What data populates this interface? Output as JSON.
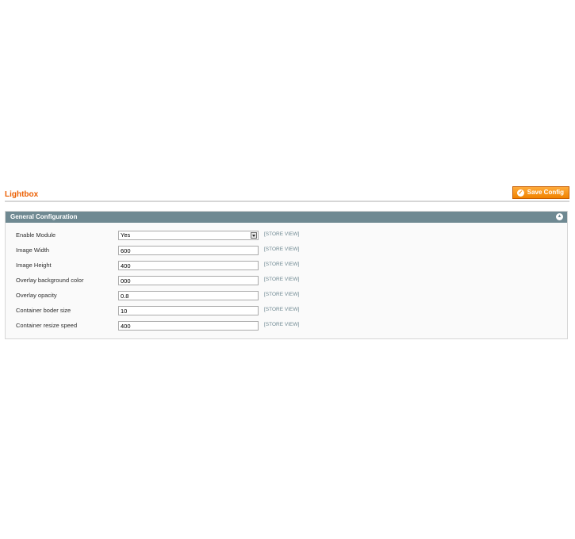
{
  "page": {
    "title": "Lightbox",
    "save_label": "Save Config"
  },
  "section": {
    "title": "General Configuration"
  },
  "fields": [
    {
      "label": "Enable Module",
      "value": "Yes",
      "scope": "[STORE VIEW]"
    },
    {
      "label": "Image Width",
      "value": "600",
      "scope": "[STORE VIEW]"
    },
    {
      "label": "Image Height",
      "value": "400",
      "scope": "[STORE VIEW]"
    },
    {
      "label": "Overlay background color",
      "value": "000",
      "scope": "[STORE VIEW]"
    },
    {
      "label": "Overlay opacity",
      "value": "0.8",
      "scope": "[STORE VIEW]"
    },
    {
      "label": "Container boder size",
      "value": "10",
      "scope": "[STORE VIEW]"
    },
    {
      "label": "Container resize speed",
      "value": "400",
      "scope": "[STORE VIEW]"
    }
  ],
  "icons": {
    "save": "check-circle-icon",
    "collapse": "chevron-up-icon"
  },
  "colors": {
    "title": "#eb5e00",
    "button": "#f18200",
    "section_header": "#6f8992",
    "scope": "#6f8992"
  }
}
